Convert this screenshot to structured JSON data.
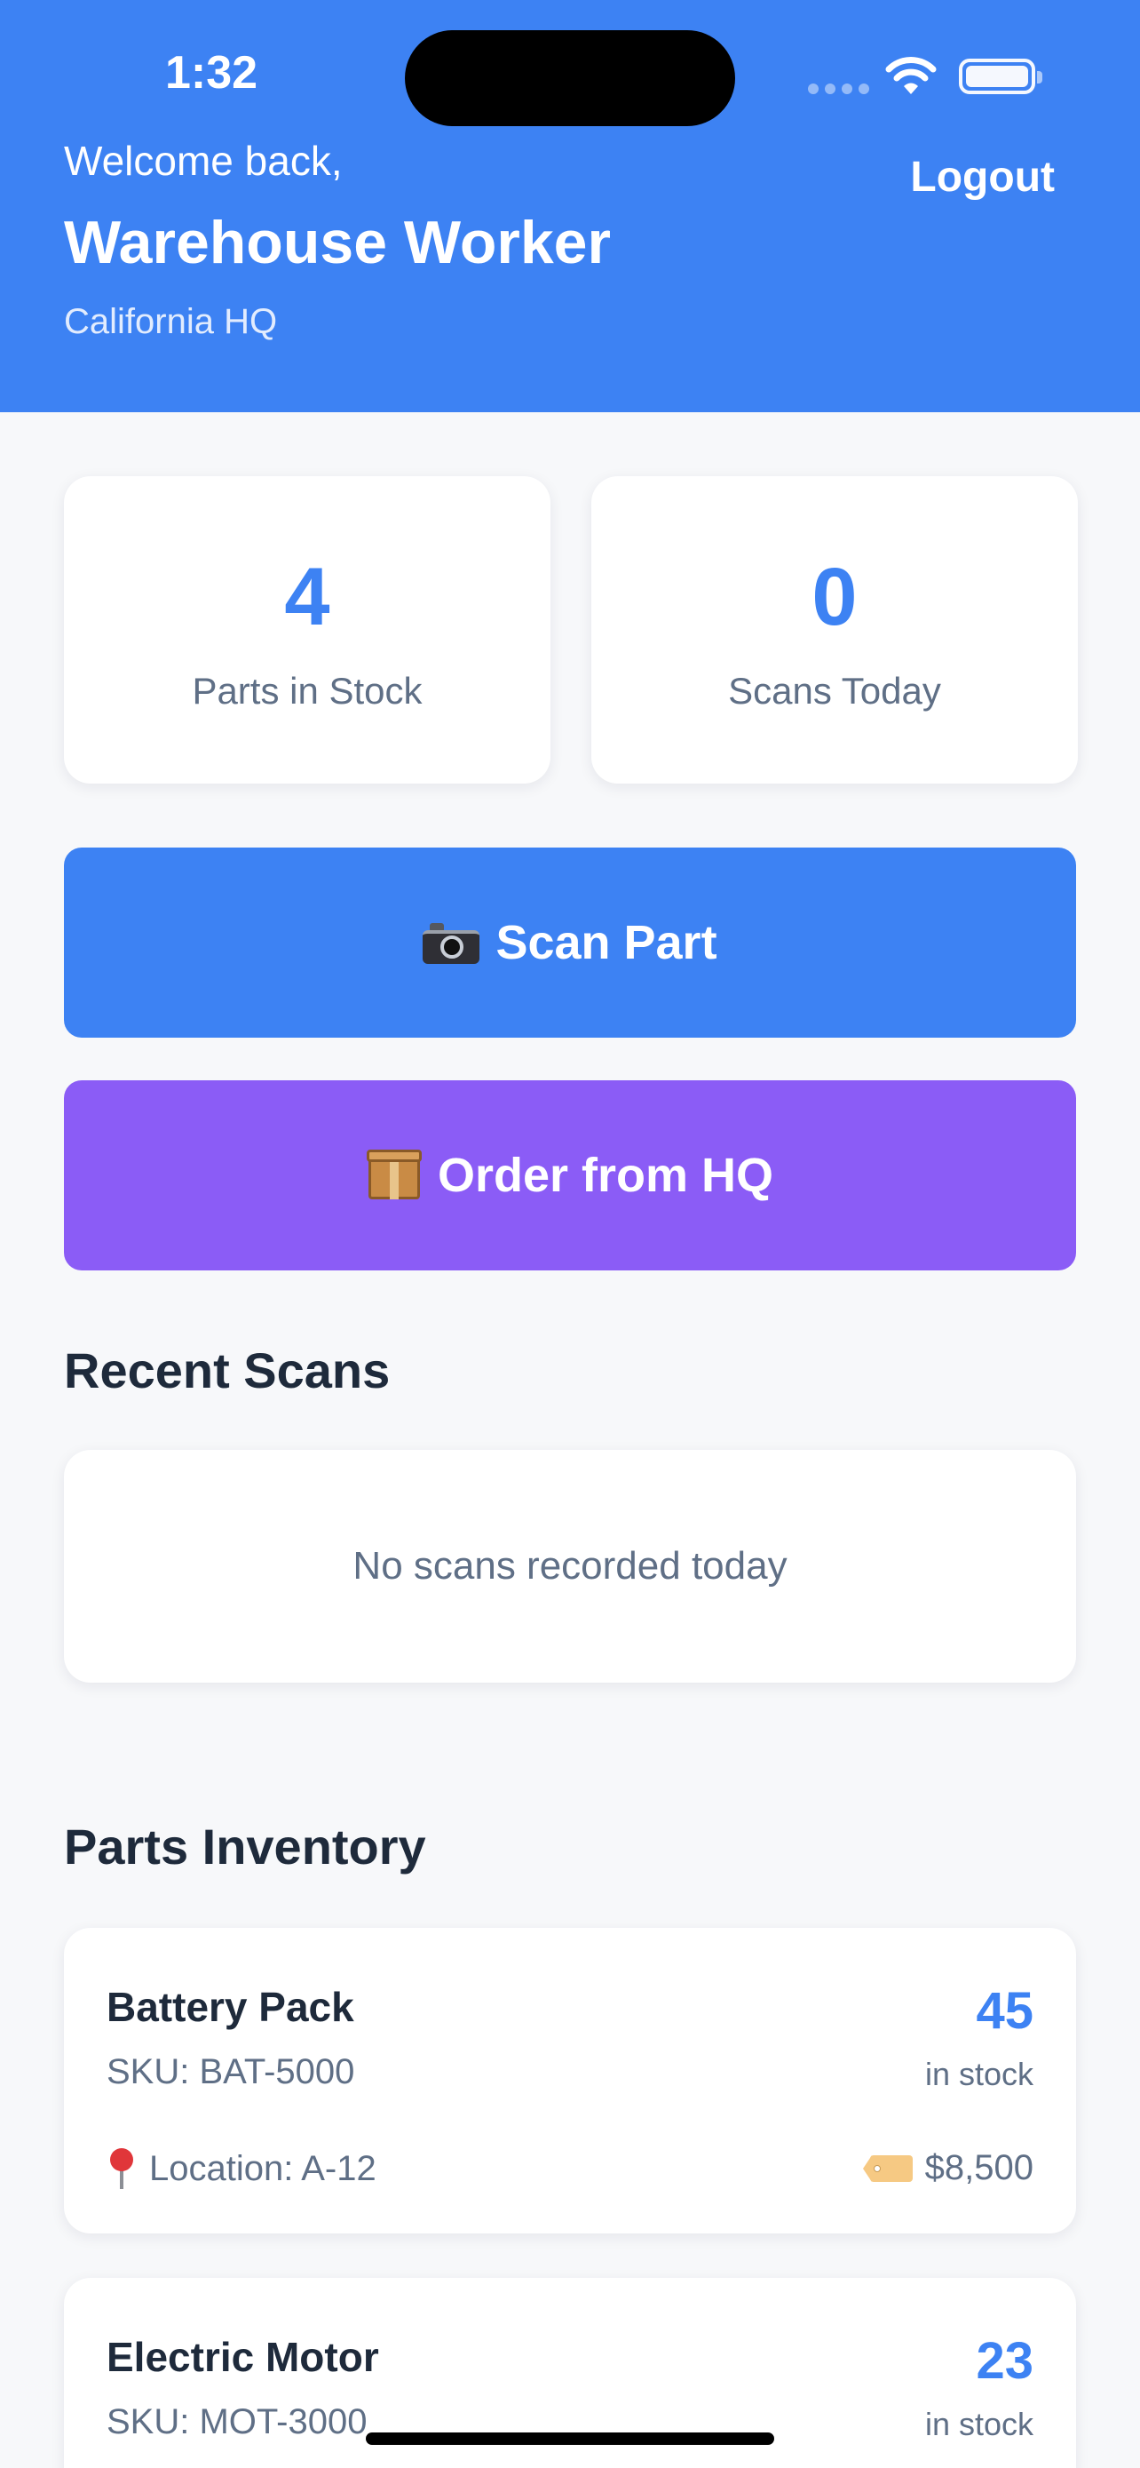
{
  "status_bar": {
    "time": "1:32"
  },
  "header": {
    "welcome": "Welcome back,",
    "user_name": "Warehouse Worker",
    "location": "California HQ",
    "logout_label": "Logout"
  },
  "stats": [
    {
      "value": "4",
      "label": "Parts in Stock"
    },
    {
      "value": "0",
      "label": "Scans Today"
    }
  ],
  "actions": {
    "scan_label": "Scan Part",
    "order_label": "Order from HQ"
  },
  "recent_scans": {
    "title": "Recent Scans",
    "empty_message": "No scans recorded today"
  },
  "inventory": {
    "title": "Parts Inventory",
    "items": [
      {
        "name": "Battery Pack",
        "sku": "SKU: BAT-5000",
        "qty": "45",
        "qty_label": "in stock",
        "location": "Location: A-12",
        "price": "$8,500"
      },
      {
        "name": "Electric Motor",
        "sku": "SKU: MOT-3000",
        "qty": "23",
        "qty_label": "in stock"
      }
    ]
  },
  "colors": {
    "primary": "#3d82f3",
    "order": "#8b5cf6",
    "text_dark": "#1e2a3b",
    "text_muted": "#5f6f86",
    "background": "#f7f8fa"
  }
}
